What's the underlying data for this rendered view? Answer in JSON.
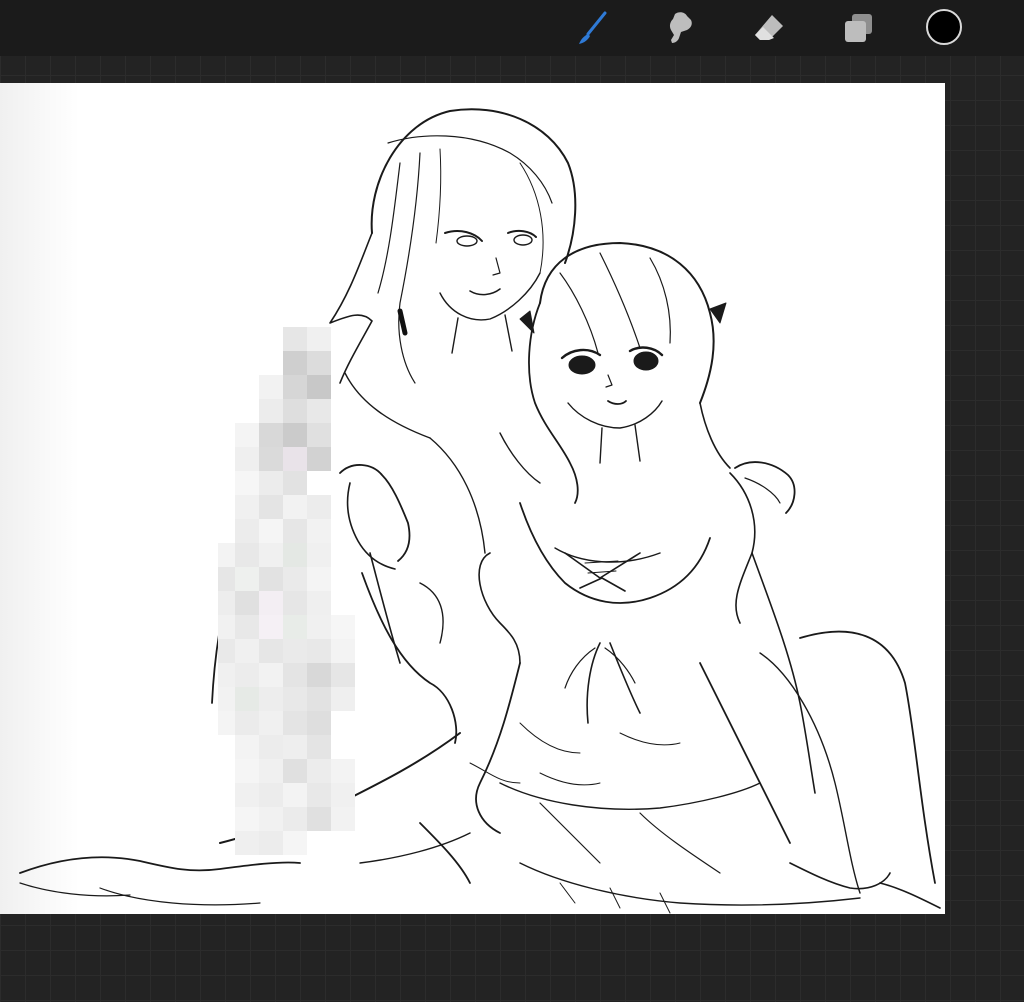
{
  "app": {
    "accent_color": "#2f7ad6",
    "current_color": "#000000",
    "active_tool": "brush"
  },
  "toolbar": {
    "tools": [
      {
        "name": "brush-tool",
        "icon": "brush-icon"
      },
      {
        "name": "smudge-tool",
        "icon": "smudge-icon"
      },
      {
        "name": "eraser-tool",
        "icon": "eraser-icon"
      },
      {
        "name": "layers-tool",
        "icon": "layers-icon"
      }
    ]
  },
  "canvas": {
    "background": "#ffffff",
    "content": "line-art-sketch"
  }
}
